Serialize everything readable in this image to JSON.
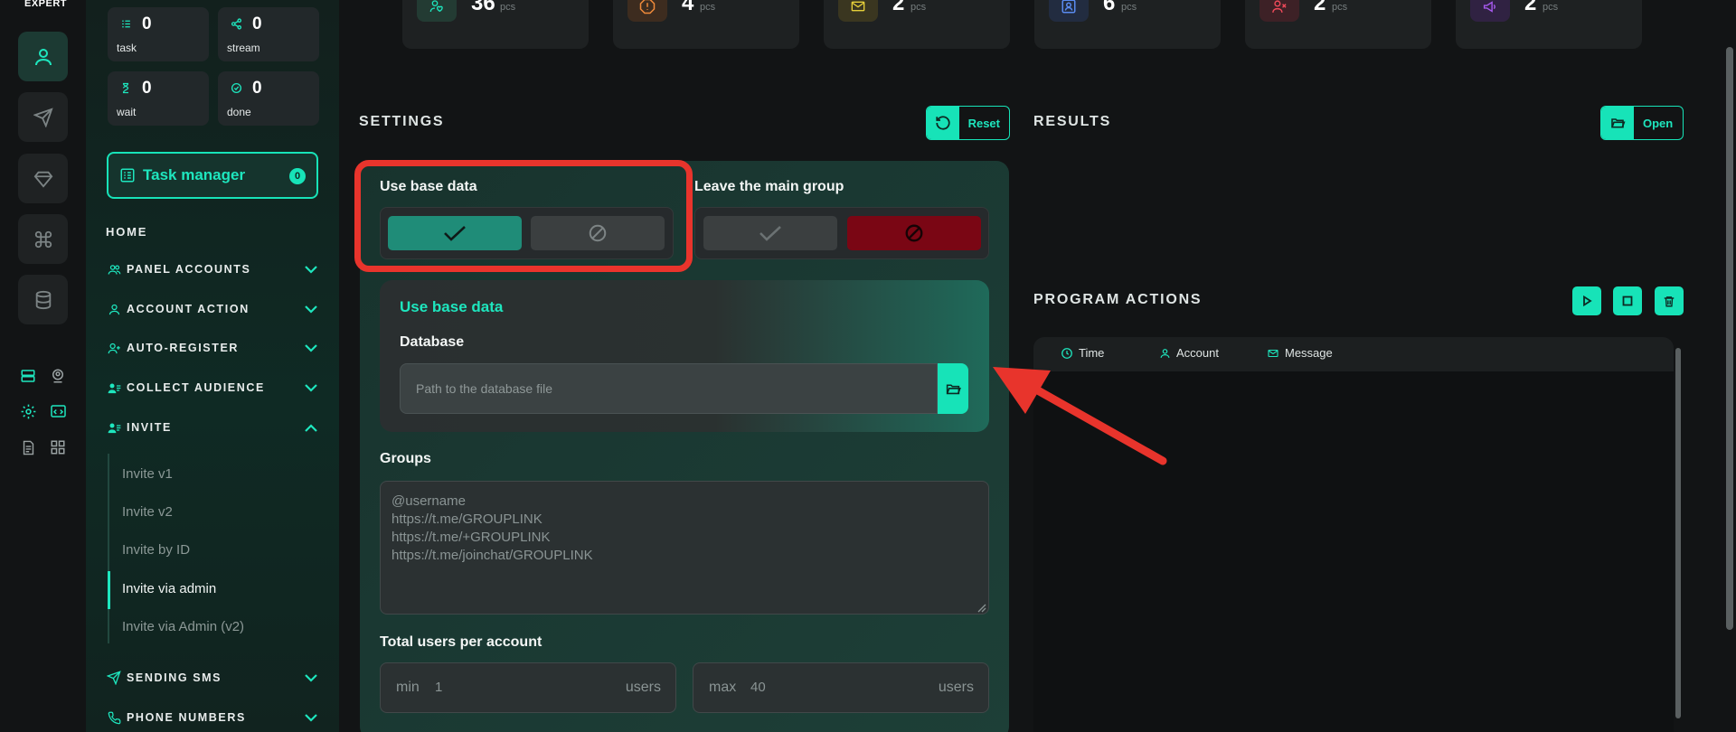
{
  "app": {
    "brand": "EXPERT"
  },
  "colors": {
    "accent": "#17e3b8",
    "highlight": "#e8342c",
    "danger": "#7a0614"
  },
  "rail": {
    "buttons": [
      "user-icon",
      "send-icon",
      "diamond-icon",
      "command-icon",
      "database-icon"
    ],
    "mini_icons": [
      "server-list-icon",
      "account-pin-icon",
      "settings-icon",
      "code-window-icon",
      "report-icon",
      "apps-icon"
    ]
  },
  "sidebar": {
    "stats": [
      {
        "value": "0",
        "label": "task",
        "icon": "tasks-icon"
      },
      {
        "value": "0",
        "label": "stream",
        "icon": "share-icon"
      },
      {
        "value": "0",
        "label": "wait",
        "icon": "hourglass-icon"
      },
      {
        "value": "0",
        "label": "done",
        "icon": "check-circle-icon"
      }
    ],
    "task_manager": {
      "label": "Task manager",
      "count": "0"
    },
    "home": "HOME",
    "nav": [
      {
        "label": "PANEL ACCOUNTS",
        "icon": "users-icon",
        "expanded": false
      },
      {
        "label": "ACCOUNT ACTION",
        "icon": "user-icon",
        "expanded": false
      },
      {
        "label": "AUTO-REGISTER",
        "icon": "user-plus-icon",
        "expanded": false
      },
      {
        "label": "COLLECT AUDIENCE",
        "icon": "user-list-icon",
        "expanded": false
      },
      {
        "label": "INVITE",
        "icon": "user-list-icon",
        "expanded": true
      },
      {
        "label": "SENDING SMS",
        "icon": "send-icon",
        "expanded": false
      },
      {
        "label": "PHONE NUMBERS",
        "icon": "phone-icon",
        "expanded": false
      }
    ],
    "invite_sub": [
      "Invite v1",
      "Invite v2",
      "Invite by ID",
      "Invite via admin",
      "Invite via Admin (v2)"
    ],
    "active_sub": "Invite via admin"
  },
  "top_stats": [
    {
      "value": "36",
      "unit": "pcs",
      "icon": "user-heart-icon",
      "color": "#2a3a34"
    },
    {
      "value": "4",
      "unit": "pcs",
      "icon": "warning-icon",
      "color": "#3a2c22"
    },
    {
      "value": "2",
      "unit": "pcs",
      "icon": "mail-icon",
      "color": "#3a3622"
    },
    {
      "value": "6",
      "unit": "pcs",
      "icon": "contact-icon",
      "color": "#232c3e"
    },
    {
      "value": "2",
      "unit": "pcs",
      "icon": "user-x-icon",
      "color": "#3a2226"
    },
    {
      "value": "2",
      "unit": "pcs",
      "icon": "megaphone-icon",
      "color": "#302442"
    }
  ],
  "settings": {
    "title": "SETTINGS",
    "reset_label": "Reset",
    "use_base_data": {
      "title": "Use base data",
      "selected": "yes"
    },
    "leave_main_group": {
      "title": "Leave the main group",
      "selected": "no"
    },
    "db_card": {
      "heading": "Use base data",
      "field_label": "Database",
      "placeholder": "Path to the database file"
    },
    "groups": {
      "label": "Groups",
      "placeholder": "@username\nhttps://t.me/GROUPLINK\nhttps://t.me/+GROUPLINK\nhttps://t.me/joinchat/GROUPLINK"
    },
    "users_per_account": {
      "label": "Total users per account",
      "min_key": "min",
      "min_value": "1",
      "max_key": "max",
      "max_value": "40",
      "unit": "users"
    }
  },
  "results": {
    "title": "RESULTS",
    "open_label": "Open"
  },
  "program_actions": {
    "title": "PROGRAM ACTIONS",
    "buttons": [
      "play-icon",
      "stop-icon",
      "trash-icon"
    ],
    "columns": [
      {
        "label": "Time",
        "icon": "clock-icon"
      },
      {
        "label": "Account",
        "icon": "user-icon"
      },
      {
        "label": "Message",
        "icon": "mail-icon"
      }
    ]
  }
}
